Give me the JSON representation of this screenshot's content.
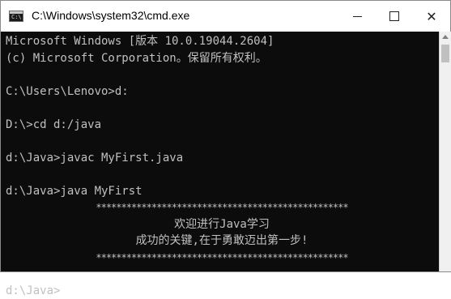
{
  "window": {
    "title": "C:\\Windows\\system32\\cmd.exe",
    "icon_label": "C:\\",
    "controls": {
      "minimize": "minimize-icon",
      "maximize": "maximize-icon",
      "close": "close-icon"
    }
  },
  "console": {
    "lines": [
      "Microsoft Windows [版本 10.0.19044.2604]",
      "(c) Microsoft Corporation。保留所有权利。",
      "",
      "C:\\Users\\Lenovo>d:",
      "",
      "D:\\>cd d:/java",
      "",
      "d:\\Java>javac MyFirst.java",
      "",
      "d:\\Java>java MyFirst",
      "**************************************************",
      "欢迎进行Java学习",
      "成功的关键,在于勇敢迈出第一步!",
      "**************************************************",
      "",
      "d:\\Java>"
    ]
  },
  "colors": {
    "background": "#0c0c0c",
    "text": "#c0c0c0",
    "titlebar": "#ffffff"
  }
}
